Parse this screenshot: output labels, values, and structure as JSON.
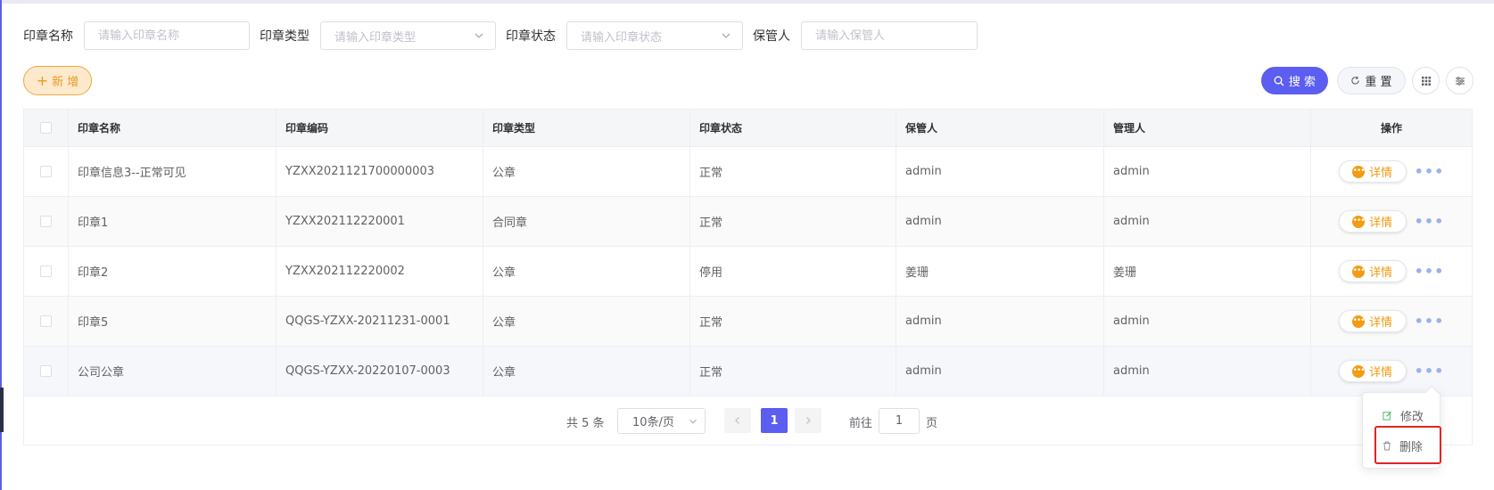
{
  "filters": [
    {
      "label": "印章名称",
      "placeholder": "请输入印章名称",
      "type": "input"
    },
    {
      "label": "印章类型",
      "placeholder": "请输入印章类型",
      "type": "select"
    },
    {
      "label": "印章状态",
      "placeholder": "请输入印章状态",
      "type": "select"
    },
    {
      "label": "保管人",
      "placeholder": "请输入保管人",
      "type": "input"
    }
  ],
  "toolbar": {
    "add_label": "新 增",
    "search_label": "搜 索",
    "reset_label": "重 置"
  },
  "table": {
    "headers": [
      "印章名称",
      "印章编码",
      "印章类型",
      "印章状态",
      "保管人",
      "管理人",
      "操作"
    ],
    "rows": [
      {
        "name": "印章信息3--正常可见",
        "code": "YZXX2021121700000003",
        "type": "公章",
        "status": "正常",
        "keeper": "admin",
        "manager": "admin"
      },
      {
        "name": "印章1",
        "code": "YZXX202112220001",
        "type": "合同章",
        "status": "正常",
        "keeper": "admin",
        "manager": "admin"
      },
      {
        "name": "印章2",
        "code": "YZXX202112220002",
        "type": "公章",
        "status": "停用",
        "keeper": "姜珊",
        "manager": "姜珊"
      },
      {
        "name": "印章5",
        "code": "QQGS-YZXX-20211231-0001",
        "type": "公章",
        "status": "正常",
        "keeper": "admin",
        "manager": "admin"
      },
      {
        "name": "公司公章",
        "code": "QQGS-YZXX-20220107-0003",
        "type": "公章",
        "status": "正常",
        "keeper": "admin",
        "manager": "admin"
      }
    ],
    "detail_label": "详情",
    "more_label": "•••"
  },
  "pagination": {
    "total_text": "共 5 条",
    "page_size": "10条/页",
    "current_page": "1",
    "goto_label": "前往",
    "goto_value": "1",
    "page_suffix": "页"
  },
  "dropdown": {
    "edit_label": "修改",
    "delete_label": "删除"
  },
  "colors": {
    "primary": "#5b5ef0",
    "warning": "#f39b12",
    "highlight": "#e02424"
  }
}
